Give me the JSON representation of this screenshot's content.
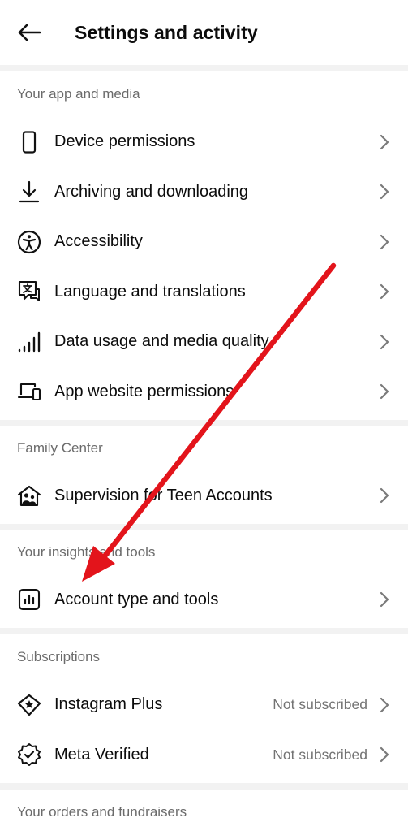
{
  "header": {
    "title": "Settings and activity",
    "back_icon": "arrow-left-icon"
  },
  "sections": {
    "app_media": {
      "label": "Your app and media",
      "items": [
        {
          "label": "Device permissions",
          "icon": "phone-icon"
        },
        {
          "label": "Archiving and downloading",
          "icon": "download-icon"
        },
        {
          "label": "Accessibility",
          "icon": "accessibility-icon"
        },
        {
          "label": "Language and translations",
          "icon": "translate-icon"
        },
        {
          "label": "Data usage and media quality",
          "icon": "signal-bars-icon"
        },
        {
          "label": "App website permissions",
          "icon": "devices-icon"
        }
      ]
    },
    "family_center": {
      "label": "Family Center",
      "items": [
        {
          "label": "Supervision for Teen Accounts",
          "icon": "family-home-icon"
        }
      ]
    },
    "insights_tools": {
      "label": "Your insights and tools",
      "items": [
        {
          "label": "Account type and tools",
          "icon": "bar-chart-icon"
        }
      ]
    },
    "subscriptions": {
      "label": "Subscriptions",
      "items": [
        {
          "label": "Instagram Plus",
          "status": "Not subscribed",
          "icon": "star-badge-icon"
        },
        {
          "label": "Meta Verified",
          "status": "Not subscribed",
          "icon": "verified-badge-icon"
        }
      ]
    },
    "orders": {
      "label": "Your orders and fundraisers"
    }
  },
  "annotation": {
    "arrow_color": "#e3141b"
  }
}
